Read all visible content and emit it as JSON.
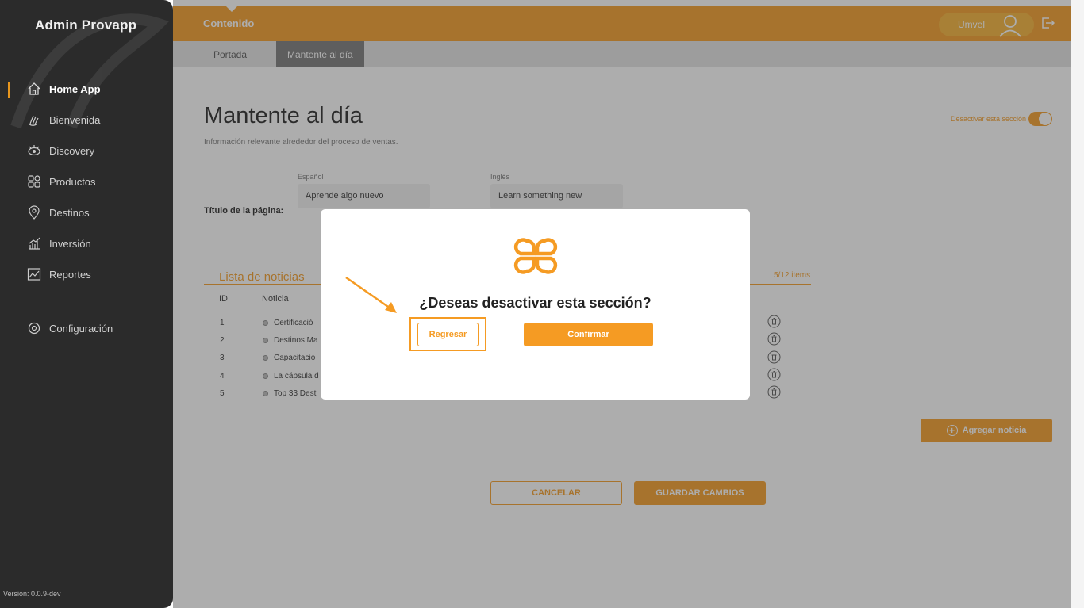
{
  "app": {
    "brand": "Admin Provapp",
    "version": "Versión: 0.0.9-dev"
  },
  "sidebar": {
    "items": [
      {
        "label": "Home App",
        "icon": "home-icon"
      },
      {
        "label": "Bienvenida",
        "icon": "clap-icon"
      },
      {
        "label": "Discovery",
        "icon": "eye-icon"
      },
      {
        "label": "Productos",
        "icon": "grid-icon"
      },
      {
        "label": "Destinos",
        "icon": "pin-icon"
      },
      {
        "label": "Inversión",
        "icon": "bar-chart-icon"
      },
      {
        "label": "Reportes",
        "icon": "trend-icon"
      }
    ],
    "settings": {
      "label": "Configuración",
      "icon": "gear-icon"
    }
  },
  "topbar": {
    "title": "Contenido",
    "user": "Umvel"
  },
  "subtabs": [
    {
      "label": "Portada"
    },
    {
      "label": "Mantente al día"
    }
  ],
  "page": {
    "title": "Mantente al día",
    "subtitle": "Información relevante alrededor del proceso de ventas.",
    "toggle_label": "Desactivar esta sección",
    "title_row_label": "Título de la página:",
    "lang_es_label": "Español",
    "lang_en_label": "Inglés",
    "title_es": "Aprende algo nuevo",
    "title_en": "Learn something new"
  },
  "list": {
    "title": "Lista de noticias",
    "count": "5/12 items",
    "col_id": "ID",
    "col_news": "Noticia",
    "rows": [
      {
        "id": "1",
        "text": "Certificació"
      },
      {
        "id": "2",
        "text": "Destinos Ma"
      },
      {
        "id": "3",
        "text": "Capacitacio"
      },
      {
        "id": "4",
        "text": "La cápsula d"
      },
      {
        "id": "5",
        "text": "Top 33 Dest"
      }
    ],
    "add_label": "Agregar noticia"
  },
  "actions": {
    "cancel": "CANCELAR",
    "save": "GUARDAR CAMBIOS"
  },
  "modal": {
    "question": "¿Deseas desactivar esta sección?",
    "back": "Regresar",
    "confirm": "Confirmar"
  },
  "colors": {
    "accent": "#f59b23",
    "sidebar": "#2b2b2b"
  }
}
